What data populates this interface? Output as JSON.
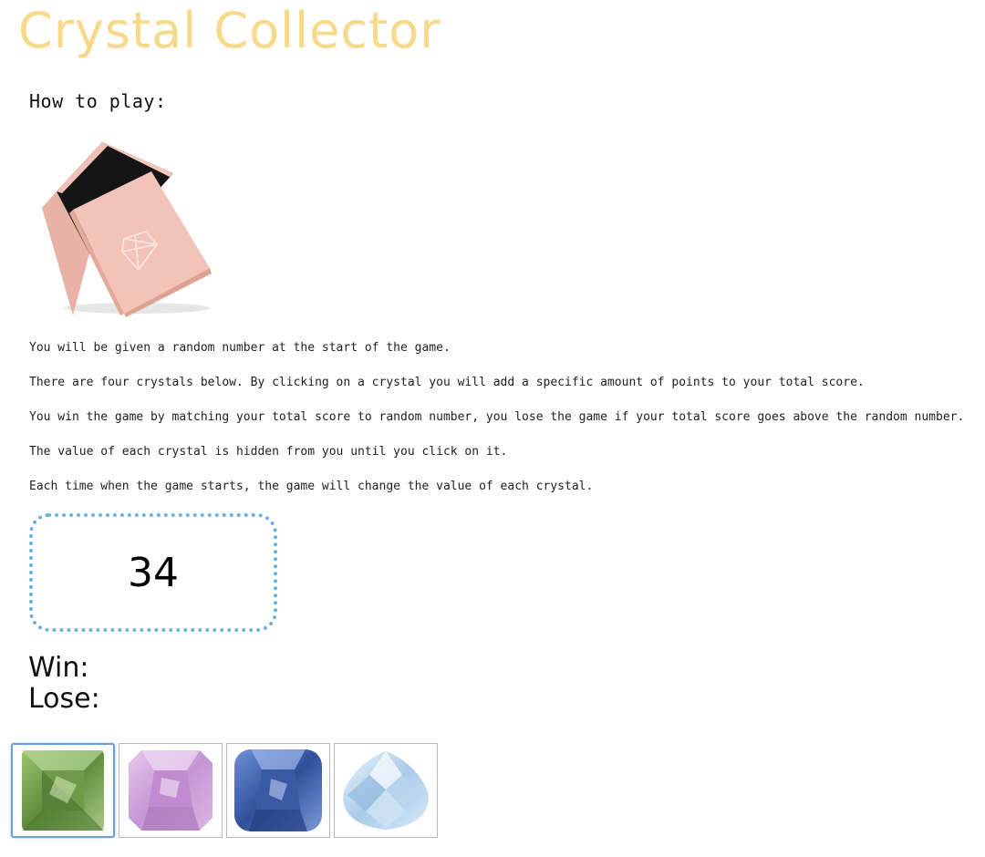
{
  "page": {
    "title": "Crystal Collector",
    "how_to_play": "How to play:"
  },
  "instructions": [
    "You will be given a random number at the start of the game.",
    "There are four crystals below. By clicking on a crystal you will add a specific amount of points to your total score.",
    "You win the game by matching your total score to random number, you lose the game if your total score goes above the random number.",
    "The value of each crystal is hidden from you until you click on it.",
    "Each time when the game starts, the game will change the value of each crystal."
  ],
  "target": {
    "number": "34"
  },
  "stats": {
    "win_label": "Win:",
    "win_value": "",
    "lose_label": "Lose:",
    "lose_value": ""
  },
  "crystals": [
    {
      "name": "green-crystal",
      "color": "#6f9a4a",
      "selected": true
    },
    {
      "name": "pink-crystal",
      "color": "#c89ad6",
      "selected": false
    },
    {
      "name": "blue-crystal",
      "color": "#3f5fa8",
      "selected": false
    },
    {
      "name": "white-crystal",
      "color": "#b9d6ee",
      "selected": false
    }
  ],
  "colors": {
    "title": "#f7d98a",
    "target_border": "#6ab3d6",
    "gift_box": "#f2c3b8"
  }
}
